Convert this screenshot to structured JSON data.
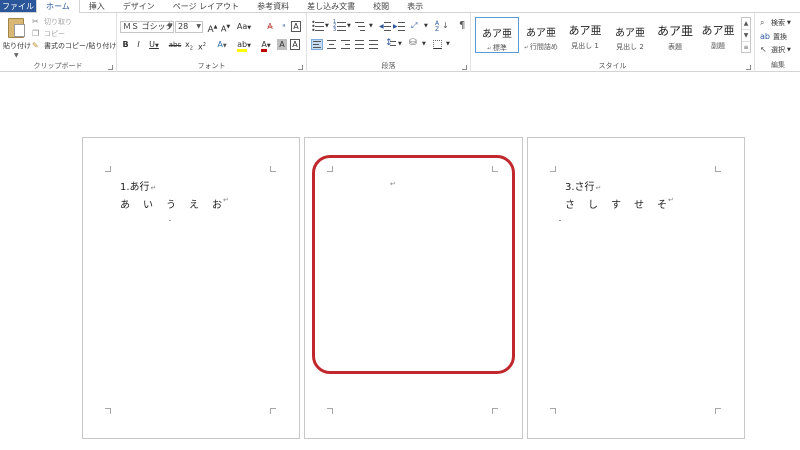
{
  "tabs": [
    {
      "label": "ファイル",
      "type": "file"
    },
    {
      "label": "ホーム",
      "type": "active"
    },
    {
      "label": "挿入"
    },
    {
      "label": "デザイン"
    },
    {
      "label": "ページ レイアウト"
    },
    {
      "label": "参考資料"
    },
    {
      "label": "差し込み文書"
    },
    {
      "label": "校閲"
    },
    {
      "label": "表示"
    }
  ],
  "clipboard": {
    "paste_label": "貼り付け",
    "cut_label": "切り取り",
    "copy_label": "コピー",
    "format_painter_label": "書式のコピー/貼り付け",
    "group_label": "クリップボード"
  },
  "font": {
    "font_name": "ＭＳ ゴシック (",
    "font_size": "28",
    "grow": "A",
    "shrink": "A",
    "case": "Aa",
    "bold": "B",
    "italic": "I",
    "underline": "U",
    "strike": "abc",
    "subscript": "x",
    "superscript": "x",
    "font_color_glyph": "A",
    "group_label": "フォント",
    "font_color": "#c00000",
    "highlight_color": "#ffff00"
  },
  "paragraph": {
    "group_label": "段落"
  },
  "styles": {
    "group_label": "スタイル",
    "items": [
      {
        "sample": "あア亜",
        "name": "標準",
        "selected": true
      },
      {
        "sample": "あア亜",
        "name": "行間詰め"
      },
      {
        "sample": "あア亜",
        "name": "見出し 1"
      },
      {
        "sample": "あア亜",
        "name": "見出し 2"
      },
      {
        "sample": "あア亜",
        "name": "表題"
      },
      {
        "sample": "あア亜",
        "name": "副題"
      }
    ]
  },
  "editing": {
    "find_label": "検索",
    "replace_label": "置換",
    "select_label": "選択",
    "group_label": "編集"
  },
  "pages": [
    {
      "heading": "1.あ行",
      "chars": [
        "あ",
        "い",
        "う",
        "え",
        "お"
      ]
    },
    {
      "heading": "",
      "chars": []
    },
    {
      "heading": "3.さ行",
      "chars": [
        "さ",
        "し",
        "す",
        "せ",
        "そ"
      ]
    }
  ],
  "highlight_color": "#c0282d"
}
